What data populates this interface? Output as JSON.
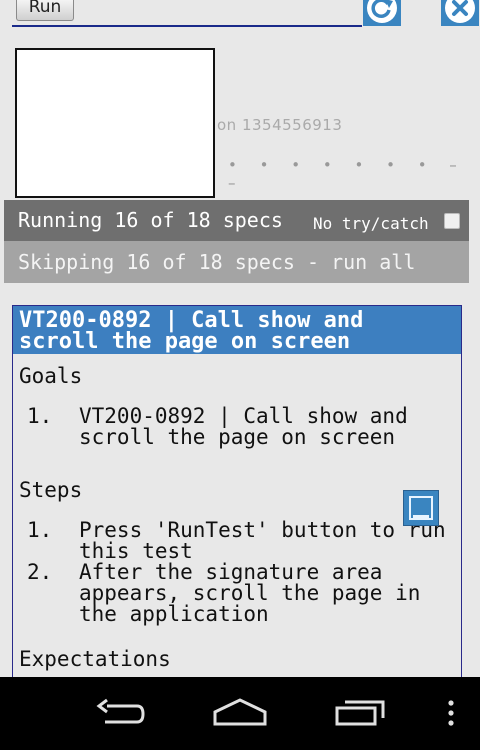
{
  "toolbar": {
    "run_label": "Run",
    "reload_icon": "reload-icon",
    "close_icon": "close-icon"
  },
  "signature": {
    "text": "on 1354556913",
    "dots": "• • • • • • • – –"
  },
  "status": {
    "running": "Running 16 of 18 specs",
    "no_try_catch_label": "No try/catch",
    "no_try_catch_checked": false,
    "skipping": "Skipping 16 of 18 specs - run all"
  },
  "spec": {
    "title": "VT200-0892 | Call show and scroll the page on screen",
    "goals_heading": "Goals",
    "goals": [
      {
        "num": "1.",
        "text": "VT200-0892 | Call show and scroll the page on screen"
      }
    ],
    "steps_heading": "Steps",
    "steps": [
      {
        "num": "1.",
        "text": "Press 'RunTest' button to run this test"
      },
      {
        "num": "2.",
        "text": "After the signature area appears, scroll the page in the application"
      }
    ],
    "expectations_heading": "Expectations"
  },
  "colors": {
    "accent": "#3d7fc0",
    "running_bg": "#6f6f6f",
    "skipping_bg": "#a4a4a4",
    "nav_bg": "#000000"
  },
  "navbar": {
    "back_icon": "back-icon",
    "home_icon": "home-icon",
    "recents_icon": "recents-icon",
    "menu_icon": "more-vert-icon"
  }
}
